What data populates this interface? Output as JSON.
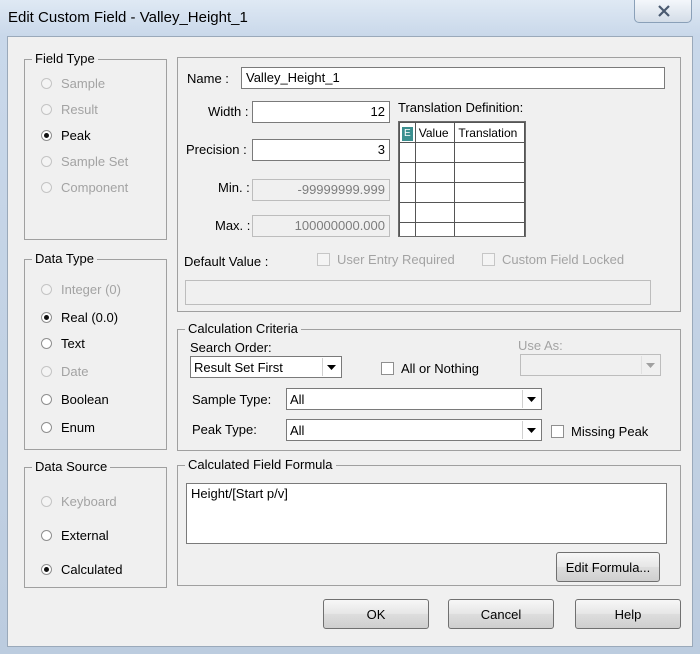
{
  "window": {
    "title": "Edit Custom Field - Valley_Height_1"
  },
  "field_type": {
    "label": "Field Type",
    "options": [
      {
        "label": "Sample",
        "selected": false,
        "enabled": false
      },
      {
        "label": "Result",
        "selected": false,
        "enabled": false
      },
      {
        "label": "Peak",
        "selected": true,
        "enabled": true
      },
      {
        "label": "Sample Set",
        "selected": false,
        "enabled": false
      },
      {
        "label": "Component",
        "selected": false,
        "enabled": false
      }
    ]
  },
  "data_type": {
    "label": "Data Type",
    "options": [
      {
        "label": "Integer (0)",
        "selected": false,
        "enabled": false
      },
      {
        "label": "Real (0.0)",
        "selected": true,
        "enabled": true
      },
      {
        "label": "Text",
        "selected": false,
        "enabled": true
      },
      {
        "label": "Date",
        "selected": false,
        "enabled": false
      },
      {
        "label": "Boolean",
        "selected": false,
        "enabled": true
      },
      {
        "label": "Enum",
        "selected": false,
        "enabled": true
      }
    ]
  },
  "data_source": {
    "label": "Data Source",
    "options": [
      {
        "label": "Keyboard",
        "selected": false,
        "enabled": false
      },
      {
        "label": "External",
        "selected": false,
        "enabled": true
      },
      {
        "label": "Calculated",
        "selected": true,
        "enabled": true
      }
    ]
  },
  "props": {
    "name_label": "Name :",
    "name_value": "Valley_Height_1",
    "width_label": "Width :",
    "width_value": "12",
    "precision_label": "Precision :",
    "precision_value": "3",
    "min_label": "Min. :",
    "min_value": "-99999999.999",
    "max_label": "Max. :",
    "max_value": "100000000.000",
    "translation_label": "Translation Definition:",
    "translation_columns": [
      "Value",
      "Translation"
    ],
    "default_label": "Default Value :",
    "default_value": "",
    "user_entry_label": "User Entry Required",
    "custom_locked_label": "Custom Field Locked"
  },
  "calc": {
    "label": "Calculation Criteria",
    "search_order_label": "Search Order:",
    "search_order_value": "Result Set First",
    "all_or_nothing_label": "All or Nothing",
    "use_as_label": "Use As:",
    "use_as_value": "",
    "sample_type_label": "Sample Type:",
    "sample_type_value": "All",
    "peak_type_label": "Peak Type:",
    "peak_type_value": "All",
    "missing_peak_label": "Missing Peak"
  },
  "formula": {
    "label": "Calculated Field Formula",
    "value": "Height/[Start p/v]",
    "edit_button": "Edit Formula..."
  },
  "buttons": {
    "ok": "OK",
    "cancel": "Cancel",
    "help": "Help"
  },
  "colors": {
    "title_gradient_top": "#dfe9f4",
    "dialog_bg": "#f0f0f0",
    "close_x": "#4a5a70"
  }
}
